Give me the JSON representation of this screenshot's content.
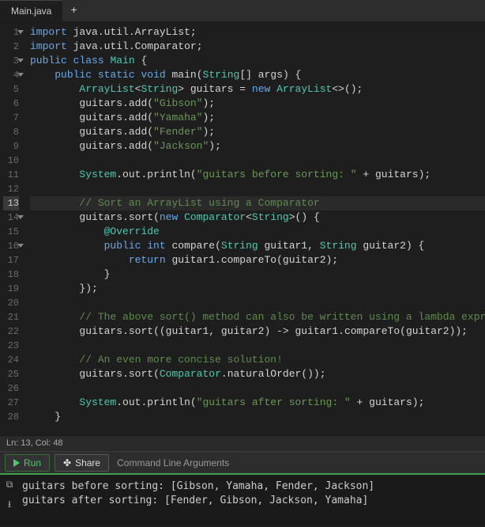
{
  "tabs": {
    "active": "Main.java",
    "add_tooltip": "+"
  },
  "status": {
    "line": 13,
    "col": 48,
    "text": "Ln: 13,  Col: 48"
  },
  "toolbar": {
    "run_label": "Run",
    "share_label": "Share",
    "cmd_placeholder": "Command Line Arguments"
  },
  "code": {
    "active_line": 13,
    "fold_lines": [
      1,
      3,
      4,
      14,
      16
    ],
    "lines": [
      {
        "n": 1,
        "tokens": [
          [
            "kw",
            "import"
          ],
          [
            "pun",
            " java"
          ],
          [
            "op",
            "."
          ],
          [
            "id",
            "util"
          ],
          [
            "op",
            "."
          ],
          [
            "id",
            "ArrayList"
          ],
          [
            "pun",
            ";"
          ]
        ]
      },
      {
        "n": 2,
        "tokens": [
          [
            "kw",
            "import"
          ],
          [
            "pun",
            " java"
          ],
          [
            "op",
            "."
          ],
          [
            "id",
            "util"
          ],
          [
            "op",
            "."
          ],
          [
            "id",
            "Comparator"
          ],
          [
            "pun",
            ";"
          ]
        ]
      },
      {
        "n": 3,
        "tokens": [
          [
            "kw",
            "public"
          ],
          [
            "pun",
            " "
          ],
          [
            "kw",
            "class"
          ],
          [
            "pun",
            " "
          ],
          [
            "type",
            "Main"
          ],
          [
            "pun",
            " {"
          ]
        ]
      },
      {
        "n": 4,
        "tokens": [
          [
            "pun",
            "    "
          ],
          [
            "kw",
            "public"
          ],
          [
            "pun",
            " "
          ],
          [
            "kw",
            "static"
          ],
          [
            "pun",
            " "
          ],
          [
            "kw",
            "void"
          ],
          [
            "pun",
            " "
          ],
          [
            "id",
            "main"
          ],
          [
            "pun",
            "("
          ],
          [
            "type",
            "String"
          ],
          [
            "pun",
            "[] args) {"
          ]
        ]
      },
      {
        "n": 5,
        "tokens": [
          [
            "pun",
            "        "
          ],
          [
            "type",
            "ArrayList"
          ],
          [
            "pun",
            "<"
          ],
          [
            "type",
            "String"
          ],
          [
            "pun",
            "> guitars "
          ],
          [
            "op",
            "="
          ],
          [
            "pun",
            " "
          ],
          [
            "kw",
            "new"
          ],
          [
            "pun",
            " "
          ],
          [
            "type",
            "ArrayList"
          ],
          [
            "pun",
            "<>();"
          ]
        ]
      },
      {
        "n": 6,
        "tokens": [
          [
            "pun",
            "        guitars"
          ],
          [
            "op",
            "."
          ],
          [
            "id",
            "add"
          ],
          [
            "pun",
            "("
          ],
          [
            "str",
            "\"Gibson\""
          ],
          [
            "pun",
            ");"
          ]
        ]
      },
      {
        "n": 7,
        "tokens": [
          [
            "pun",
            "        guitars"
          ],
          [
            "op",
            "."
          ],
          [
            "id",
            "add"
          ],
          [
            "pun",
            "("
          ],
          [
            "str",
            "\"Yamaha\""
          ],
          [
            "pun",
            ");"
          ]
        ]
      },
      {
        "n": 8,
        "tokens": [
          [
            "pun",
            "        guitars"
          ],
          [
            "op",
            "."
          ],
          [
            "id",
            "add"
          ],
          [
            "pun",
            "("
          ],
          [
            "str",
            "\"Fender\""
          ],
          [
            "pun",
            ");"
          ]
        ]
      },
      {
        "n": 9,
        "tokens": [
          [
            "pun",
            "        guitars"
          ],
          [
            "op",
            "."
          ],
          [
            "id",
            "add"
          ],
          [
            "pun",
            "("
          ],
          [
            "str",
            "\"Jackson\""
          ],
          [
            "pun",
            ");"
          ]
        ]
      },
      {
        "n": 10,
        "tokens": [
          [
            "pun",
            ""
          ]
        ]
      },
      {
        "n": 11,
        "tokens": [
          [
            "pun",
            "        "
          ],
          [
            "type",
            "System"
          ],
          [
            "op",
            "."
          ],
          [
            "id",
            "out"
          ],
          [
            "op",
            "."
          ],
          [
            "id",
            "println"
          ],
          [
            "pun",
            "("
          ],
          [
            "str",
            "\"guitars before sorting: \""
          ],
          [
            "pun",
            " "
          ],
          [
            "op",
            "+"
          ],
          [
            "pun",
            " guitars);"
          ]
        ]
      },
      {
        "n": 12,
        "tokens": [
          [
            "pun",
            ""
          ]
        ]
      },
      {
        "n": 13,
        "tokens": [
          [
            "pun",
            "        "
          ],
          [
            "cmt",
            "// Sort an ArrayList using a Comparator"
          ]
        ]
      },
      {
        "n": 14,
        "tokens": [
          [
            "pun",
            "        guitars"
          ],
          [
            "op",
            "."
          ],
          [
            "id",
            "sort"
          ],
          [
            "pun",
            "("
          ],
          [
            "kw",
            "new"
          ],
          [
            "pun",
            " "
          ],
          [
            "type",
            "Comparator"
          ],
          [
            "pun",
            "<"
          ],
          [
            "type",
            "String"
          ],
          [
            "pun",
            ">() {"
          ]
        ]
      },
      {
        "n": 15,
        "tokens": [
          [
            "pun",
            "            "
          ],
          [
            "ann",
            "@Override"
          ]
        ]
      },
      {
        "n": 16,
        "tokens": [
          [
            "pun",
            "            "
          ],
          [
            "kw",
            "public"
          ],
          [
            "pun",
            " "
          ],
          [
            "kw",
            "int"
          ],
          [
            "pun",
            " "
          ],
          [
            "id",
            "compare"
          ],
          [
            "pun",
            "("
          ],
          [
            "type",
            "String"
          ],
          [
            "pun",
            " guitar1, "
          ],
          [
            "type",
            "String"
          ],
          [
            "pun",
            " guitar2) {"
          ]
        ]
      },
      {
        "n": 17,
        "tokens": [
          [
            "pun",
            "                "
          ],
          [
            "kw",
            "return"
          ],
          [
            "pun",
            " guitar1"
          ],
          [
            "op",
            "."
          ],
          [
            "id",
            "compareTo"
          ],
          [
            "pun",
            "(guitar2);"
          ]
        ]
      },
      {
        "n": 18,
        "tokens": [
          [
            "pun",
            "            }"
          ]
        ]
      },
      {
        "n": 19,
        "tokens": [
          [
            "pun",
            "        });"
          ]
        ]
      },
      {
        "n": 20,
        "tokens": [
          [
            "pun",
            ""
          ]
        ]
      },
      {
        "n": 21,
        "tokens": [
          [
            "pun",
            "        "
          ],
          [
            "cmt",
            "// The above sort() method can also be written using a lambda expression"
          ]
        ]
      },
      {
        "n": 22,
        "tokens": [
          [
            "pun",
            "        guitars"
          ],
          [
            "op",
            "."
          ],
          [
            "id",
            "sort"
          ],
          [
            "pun",
            "((guitar1, guitar2) "
          ],
          [
            "op",
            "->"
          ],
          [
            "pun",
            " guitar1"
          ],
          [
            "op",
            "."
          ],
          [
            "id",
            "compareTo"
          ],
          [
            "pun",
            "(guitar2));"
          ]
        ]
      },
      {
        "n": 23,
        "tokens": [
          [
            "pun",
            ""
          ]
        ]
      },
      {
        "n": 24,
        "tokens": [
          [
            "pun",
            "        "
          ],
          [
            "cmt",
            "// An even more concise solution!"
          ]
        ]
      },
      {
        "n": 25,
        "tokens": [
          [
            "pun",
            "        guitars"
          ],
          [
            "op",
            "."
          ],
          [
            "id",
            "sort"
          ],
          [
            "pun",
            "("
          ],
          [
            "type",
            "Comparator"
          ],
          [
            "op",
            "."
          ],
          [
            "id",
            "naturalOrder"
          ],
          [
            "pun",
            "());"
          ]
        ]
      },
      {
        "n": 26,
        "tokens": [
          [
            "pun",
            ""
          ]
        ]
      },
      {
        "n": 27,
        "tokens": [
          [
            "pun",
            "        "
          ],
          [
            "type",
            "System"
          ],
          [
            "op",
            "."
          ],
          [
            "id",
            "out"
          ],
          [
            "op",
            "."
          ],
          [
            "id",
            "println"
          ],
          [
            "pun",
            "("
          ],
          [
            "str",
            "\"guitars after sorting: \""
          ],
          [
            "pun",
            " "
          ],
          [
            "op",
            "+"
          ],
          [
            "pun",
            " guitars);"
          ]
        ]
      },
      {
        "n": 28,
        "tokens": [
          [
            "pun",
            "    }"
          ]
        ]
      }
    ]
  },
  "console": {
    "lines": [
      "guitars before sorting: [Gibson, Yamaha, Fender, Jackson]",
      "guitars after sorting: [Fender, Gibson, Jackson, Yamaha]"
    ]
  }
}
